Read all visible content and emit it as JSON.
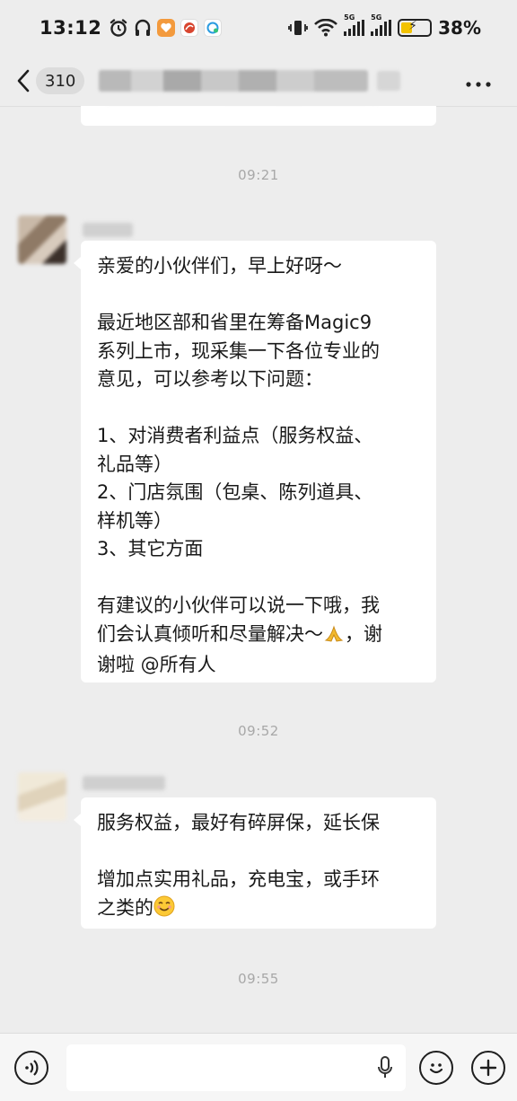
{
  "status_bar": {
    "time": "13:12",
    "battery_percent": "38%",
    "battery_level": 0.38,
    "network_1": "5G",
    "network_2": "5G",
    "icons": [
      "alarm-icon",
      "headphones-icon",
      "orange-app-icon",
      "red-app-icon",
      "chat-app-icon",
      "vibrate-icon",
      "wifi-icon",
      "signal-icon",
      "battery-icon"
    ]
  },
  "header": {
    "back_count": "310",
    "icons": [
      "back-chevron-icon",
      "more-icon"
    ]
  },
  "messages": [
    {
      "time": "09:21",
      "text": "亲爱的小伙伴们，早上好呀～\n\n最近地区部和省里在筹备Magic9\n系列上市，现采集一下各位专业的\n意见，可以参考以下问题：\n\n1、对消费者利益点（服务权益、\n礼品等）\n2、门店氛围（包桌、陈列道具、\n样机等）\n3、其它方面\n\n有建议的小伙伴可以说一下哦，我\n们会认真倾听和尽量解决～",
      "text_tail": "，谢\n谢啦 @所有人",
      "emoji": "praying-hands-emoji"
    },
    {
      "time": "09:52",
      "text": "服务权益，最好有碎屏保，延长保\n\n增加点实用礼品，充电宝，或手环\n之类的",
      "emoji": "smiling-face-emoji"
    }
  ],
  "trailing_time": "09:55",
  "bottom_bar": {
    "icons": [
      "voice-icon",
      "mic-icon",
      "emoji-icon",
      "plus-icon"
    ]
  },
  "colors": {
    "background": "#ededed",
    "bubble": "#ffffff",
    "time_text": "#a8a8a8",
    "battery_fill": "#f2c200"
  }
}
